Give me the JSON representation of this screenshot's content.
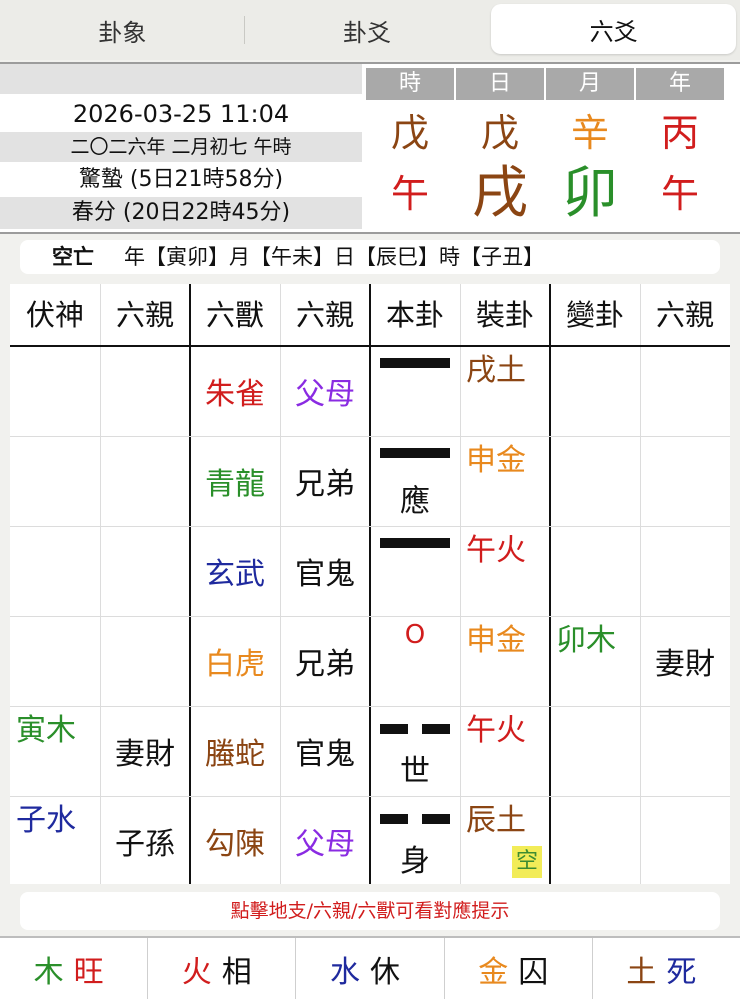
{
  "tabs": [
    {
      "label": "卦象",
      "active": false
    },
    {
      "label": "卦爻",
      "active": false
    },
    {
      "label": "六爻",
      "active": true
    }
  ],
  "info": {
    "datetime": "2026-03-25 11:04",
    "lunar": "二〇二六年 二月初七 午時",
    "term1": "驚蟄 (5日21時58分)",
    "term2": "春分 (20日22時45分)"
  },
  "pillars": {
    "headers": [
      "時",
      "日",
      "月",
      "年"
    ],
    "gan": [
      {
        "text": "戊",
        "color": "#8b4513"
      },
      {
        "text": "戊",
        "color": "#8b4513"
      },
      {
        "text": "辛",
        "color": "#e8891e"
      },
      {
        "text": "丙",
        "color": "#d11d1d"
      }
    ],
    "zhi": [
      {
        "text": "午",
        "color": "#d11d1d"
      },
      {
        "text": "戌",
        "color": "#8b4513"
      },
      {
        "text": "卯",
        "color": "#2a8f2a"
      },
      {
        "text": "午",
        "color": "#d11d1d"
      }
    ]
  },
  "kongwang": {
    "label": "空亡",
    "text": "年【寅卯】月【午未】日【辰巳】時【子丑】"
  },
  "table": {
    "headers": [
      "伏神",
      "六親",
      "六獸",
      "六親",
      "本卦",
      "裝卦",
      "變卦",
      "六親"
    ],
    "rows": [
      {
        "fushen": "",
        "fushen_color": "#111",
        "fs_liuqin": "",
        "beast": "朱雀",
        "beast_color": "#d11d1d",
        "liuqin": "父母",
        "liuqin_color": "#8a2be2",
        "line": "yang",
        "mark": "",
        "moving": "",
        "zhuang": "戌土",
        "zhuang_color": "#8b4513",
        "bian": "",
        "bian_color": "#2a8f2a",
        "bian_liuqin": "",
        "kong": ""
      },
      {
        "fushen": "",
        "fushen_color": "#111",
        "fs_liuqin": "",
        "beast": "青龍",
        "beast_color": "#2a8f2a",
        "liuqin": "兄弟",
        "liuqin_color": "#111",
        "line": "yang",
        "mark": "應",
        "moving": "",
        "zhuang": "申金",
        "zhuang_color": "#e8891e",
        "bian": "",
        "bian_color": "#2a8f2a",
        "bian_liuqin": "",
        "kong": ""
      },
      {
        "fushen": "",
        "fushen_color": "#111",
        "fs_liuqin": "",
        "beast": "玄武",
        "beast_color": "#1f2a9e",
        "liuqin": "官鬼",
        "liuqin_color": "#111",
        "line": "yang",
        "mark": "",
        "moving": "",
        "zhuang": "午火",
        "zhuang_color": "#d11d1d",
        "bian": "",
        "bian_color": "#2a8f2a",
        "bian_liuqin": "",
        "kong": ""
      },
      {
        "fushen": "",
        "fushen_color": "#111",
        "fs_liuqin": "",
        "beast": "白虎",
        "beast_color": "#e8891e",
        "liuqin": "兄弟",
        "liuqin_color": "#111",
        "line": "none",
        "mark": "",
        "moving": "O",
        "zhuang": "申金",
        "zhuang_color": "#e8891e",
        "bian": "卯木",
        "bian_color": "#2a8f2a",
        "bian_liuqin": "妻財",
        "kong": ""
      },
      {
        "fushen": "寅木",
        "fushen_color": "#2a8f2a",
        "fs_liuqin": "妻財",
        "beast": "螣蛇",
        "beast_color": "#8b4513",
        "liuqin": "官鬼",
        "liuqin_color": "#111",
        "line": "yin",
        "mark": "世",
        "moving": "",
        "zhuang": "午火",
        "zhuang_color": "#d11d1d",
        "bian": "",
        "bian_color": "#2a8f2a",
        "bian_liuqin": "",
        "kong": ""
      },
      {
        "fushen": "子水",
        "fushen_color": "#1f2a9e",
        "fs_liuqin": "子孫",
        "beast": "勾陳",
        "beast_color": "#8b4513",
        "liuqin": "父母",
        "liuqin_color": "#8a2be2",
        "line": "yin",
        "mark": "身",
        "moving": "",
        "zhuang": "辰土",
        "zhuang_color": "#8b4513",
        "bian": "",
        "bian_color": "#2a8f2a",
        "bian_liuqin": "",
        "kong": "空"
      }
    ]
  },
  "tip": "點擊地支/六親/六獸可看對應提示",
  "status": [
    {
      "element": "木",
      "state": "旺",
      "color": "#2a8f2a",
      "state_color": "#d11d1d"
    },
    {
      "element": "火",
      "state": "相",
      "color": "#d11d1d",
      "state_color": "#111"
    },
    {
      "element": "水",
      "state": "休",
      "color": "#1f2a9e",
      "state_color": "#111"
    },
    {
      "element": "金",
      "state": "囚",
      "color": "#e8891e",
      "state_color": "#111"
    },
    {
      "element": "土",
      "state": "死",
      "color": "#8b4513",
      "state_color": "#1f2a9e"
    }
  ]
}
